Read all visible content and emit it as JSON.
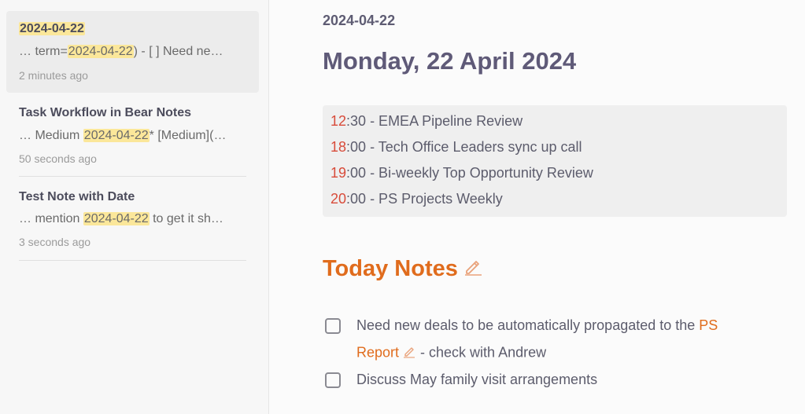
{
  "sidebar": {
    "notes": [
      {
        "title": "2024-04-22",
        "snippet_pre": "… term=",
        "snippet_hl": "2024-04-22",
        "snippet_post": ")  - [ ] Need ne…",
        "time": "2 minutes ago"
      },
      {
        "title": "Task Workflow in Bear Notes",
        "snippet_pre": "… Medium ",
        "snippet_hl": "2024-04-22",
        "snippet_post": "* [Medium](…",
        "time": "50 seconds ago"
      },
      {
        "title": "Test Note with Date",
        "snippet_pre": "… mention ",
        "snippet_hl": "2024-04-22",
        "snippet_post": " to get it sh…",
        "time": "3 seconds ago"
      }
    ]
  },
  "editor": {
    "date_heading": "2024-04-22",
    "title": "Monday, 22 April 2024",
    "calendar": [
      {
        "time_h": "12",
        "time_m": ":30",
        "text": " - EMEA Pipeline Review"
      },
      {
        "time_h": "18",
        "time_m": ":00",
        "text": " - Tech Office Leaders sync up call"
      },
      {
        "time_h": "19",
        "time_m": ":00",
        "text": " - Bi-weekly Top Opportunity Review"
      },
      {
        "time_h": "20",
        "time_m": ":00",
        "text": " - PS Projects Weekly"
      }
    ],
    "section_title": "Today Notes",
    "tasks": [
      {
        "line1_text": "Need new deals to be automatically propagated to the ",
        "line1_link": "PS",
        "line2_link": "Report",
        "line2_text": " - check with Andrew",
        "checked": false
      },
      {
        "text": "Discuss May family visit arrangements",
        "checked": false
      }
    ]
  },
  "colors": {
    "accent": "#e06c1d",
    "time": "#d84b3a",
    "title": "#5f5a78",
    "highlight": "#fbe79a"
  },
  "icons": {
    "pencil": "pencil-icon",
    "checkbox": "checkbox-icon"
  }
}
